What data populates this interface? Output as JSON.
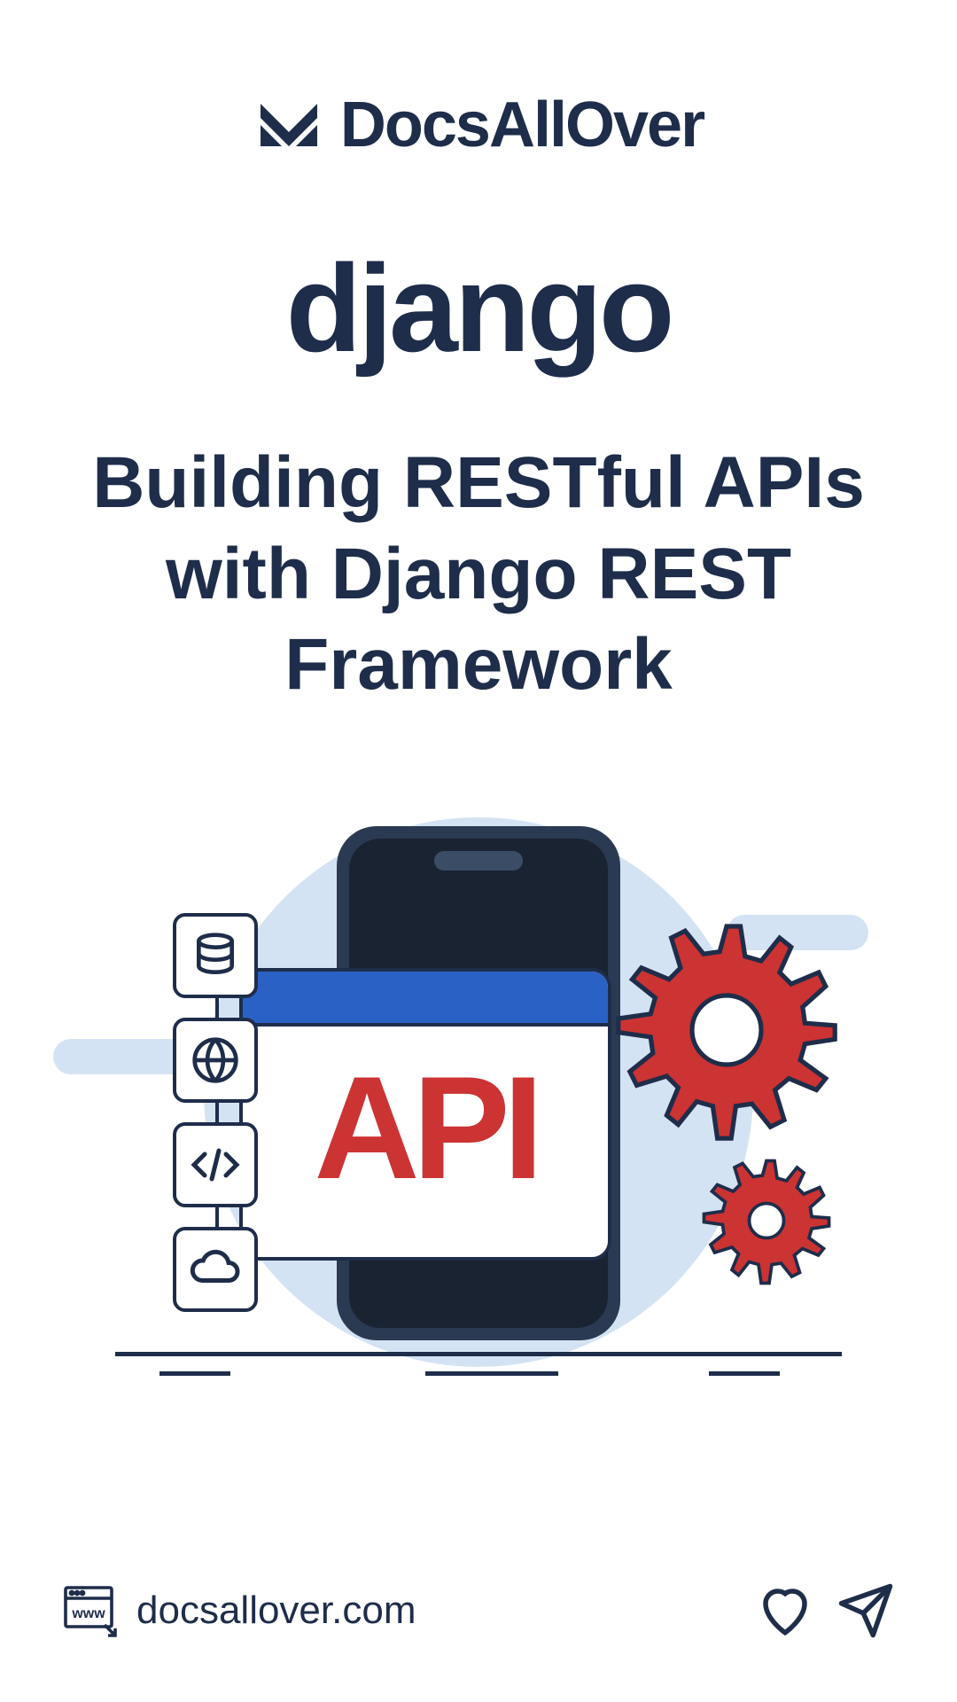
{
  "header": {
    "brand_name": "DocsAllOver"
  },
  "framework_logo": "django",
  "headline": "Building RESTful APIs with Django REST Framework",
  "illustration": {
    "api_label": "API",
    "icons": [
      "database-icon",
      "globe-icon",
      "code-icon",
      "cloud-icon"
    ]
  },
  "footer": {
    "url": "docsallover.com"
  },
  "colors": {
    "primary": "#1e2d4a",
    "accent_red": "#cc3333",
    "accent_blue": "#2962c4",
    "bg_light": "#d4e3f3"
  }
}
